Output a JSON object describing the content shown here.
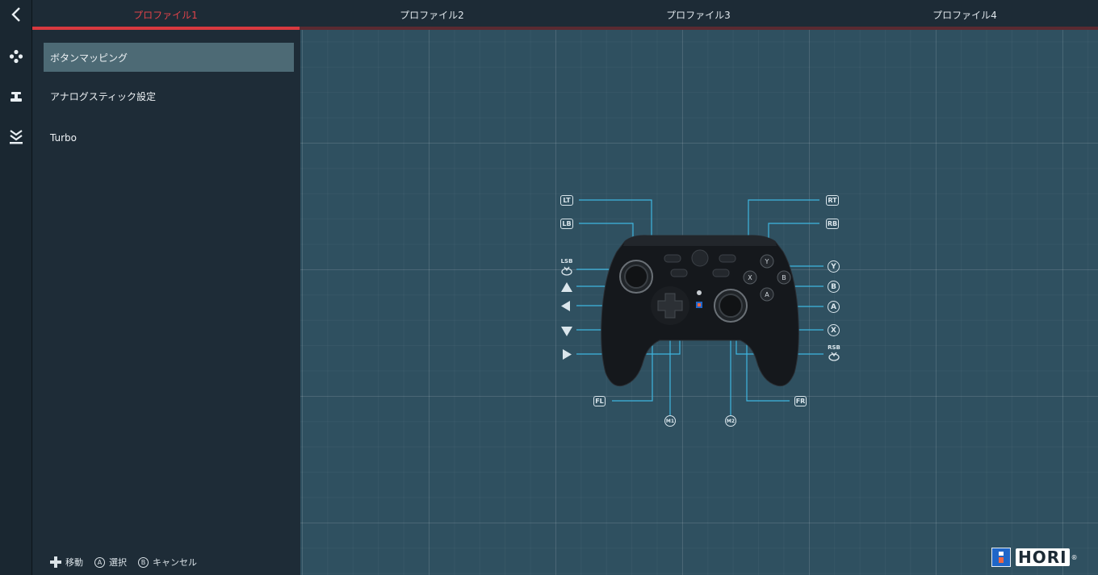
{
  "tabs": [
    {
      "label": "プロファイル1"
    },
    {
      "label": "プロファイル2"
    },
    {
      "label": "プロファイル3"
    },
    {
      "label": "プロファイル4"
    }
  ],
  "menu": {
    "items": [
      {
        "label": "ボタンマッピング"
      },
      {
        "label": "アナログスティック設定"
      },
      {
        "label": "Turbo"
      }
    ]
  },
  "hints": {
    "move": "移動",
    "select_glyph": "A",
    "select": "選択",
    "cancel_glyph": "B",
    "cancel": "キャンセル"
  },
  "controller_labels": {
    "lt": "LT",
    "lb": "LB",
    "rt": "RT",
    "rb": "RB",
    "lsb": "LSB",
    "rsb": "RSB",
    "y": "Y",
    "b": "B",
    "a": "A",
    "x": "X",
    "fl": "FL",
    "fr": "FR",
    "m1": "M1",
    "m2": "M2"
  },
  "logo": {
    "text": "HORI",
    "reg": "®"
  },
  "colors": {
    "accent": "#d8393f",
    "selected": "#4d6a75",
    "blueprint": "#2f5060",
    "callout_line": "#3fb6e0"
  },
  "icons": [
    "back-chevron-icon",
    "gamepad-dpad-icon",
    "joystick-icon",
    "turbo-chevrons-icon",
    "dpad-cross-icon"
  ]
}
